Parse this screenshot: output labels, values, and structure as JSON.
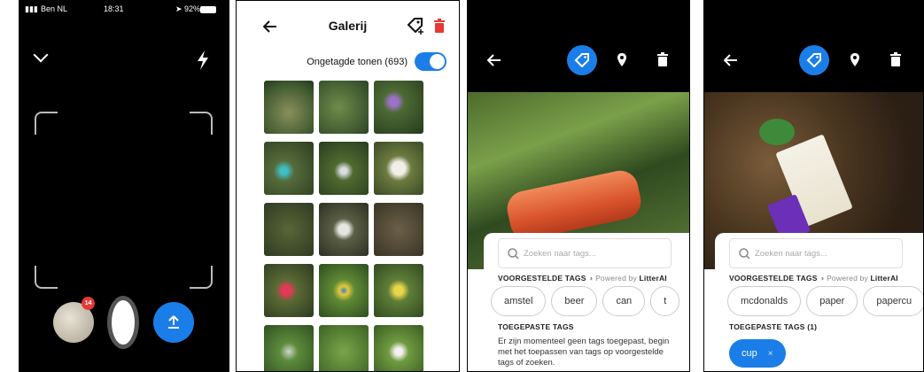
{
  "camera": {
    "carrier": "Ben NL",
    "time": "18:31",
    "battery": "92%",
    "photo_count_badge": "14",
    "icons": [
      "signal-icon",
      "wifi-icon",
      "location-arrow-icon",
      "battery-icon",
      "chevron-down-icon",
      "flash-icon",
      "upload-icon"
    ]
  },
  "gallery": {
    "title": "Galerij",
    "toggle_label": "Ongetagde tonen (693)",
    "toggle_on": true,
    "icons": [
      "back-arrow-icon",
      "tag-add-icon",
      "trash-icon"
    ],
    "thumbnails": 15
  },
  "tagging1": {
    "search_placeholder": "Zoeken naar tags...",
    "suggested_label": "VOORGESTELDE TAGS",
    "powered_by": "Powered by",
    "brand": "LitterAI",
    "suggestions": [
      "amstel",
      "beer",
      "can",
      "t"
    ],
    "applied_label": "TOEGEPASTE TAGS",
    "empty_note": "Er zijn momenteel geen tags toegepast, begin met het toepassen van tags op voorgestelde tags of zoeken."
  },
  "tagging2": {
    "search_placeholder": "Zoeken naar tags...",
    "suggested_label": "VOORGESTELDE TAGS",
    "powered_by": "Powered by",
    "brand": "LitterAI",
    "suggestions": [
      "mcdonalds",
      "paper",
      "papercu"
    ],
    "applied_label": "TOEGEPASTE TAGS (1)",
    "applied_tags": [
      {
        "label": "cup",
        "remove": "×"
      }
    ]
  },
  "colors": {
    "accent": "#1b7ee8",
    "danger": "#e53935"
  }
}
